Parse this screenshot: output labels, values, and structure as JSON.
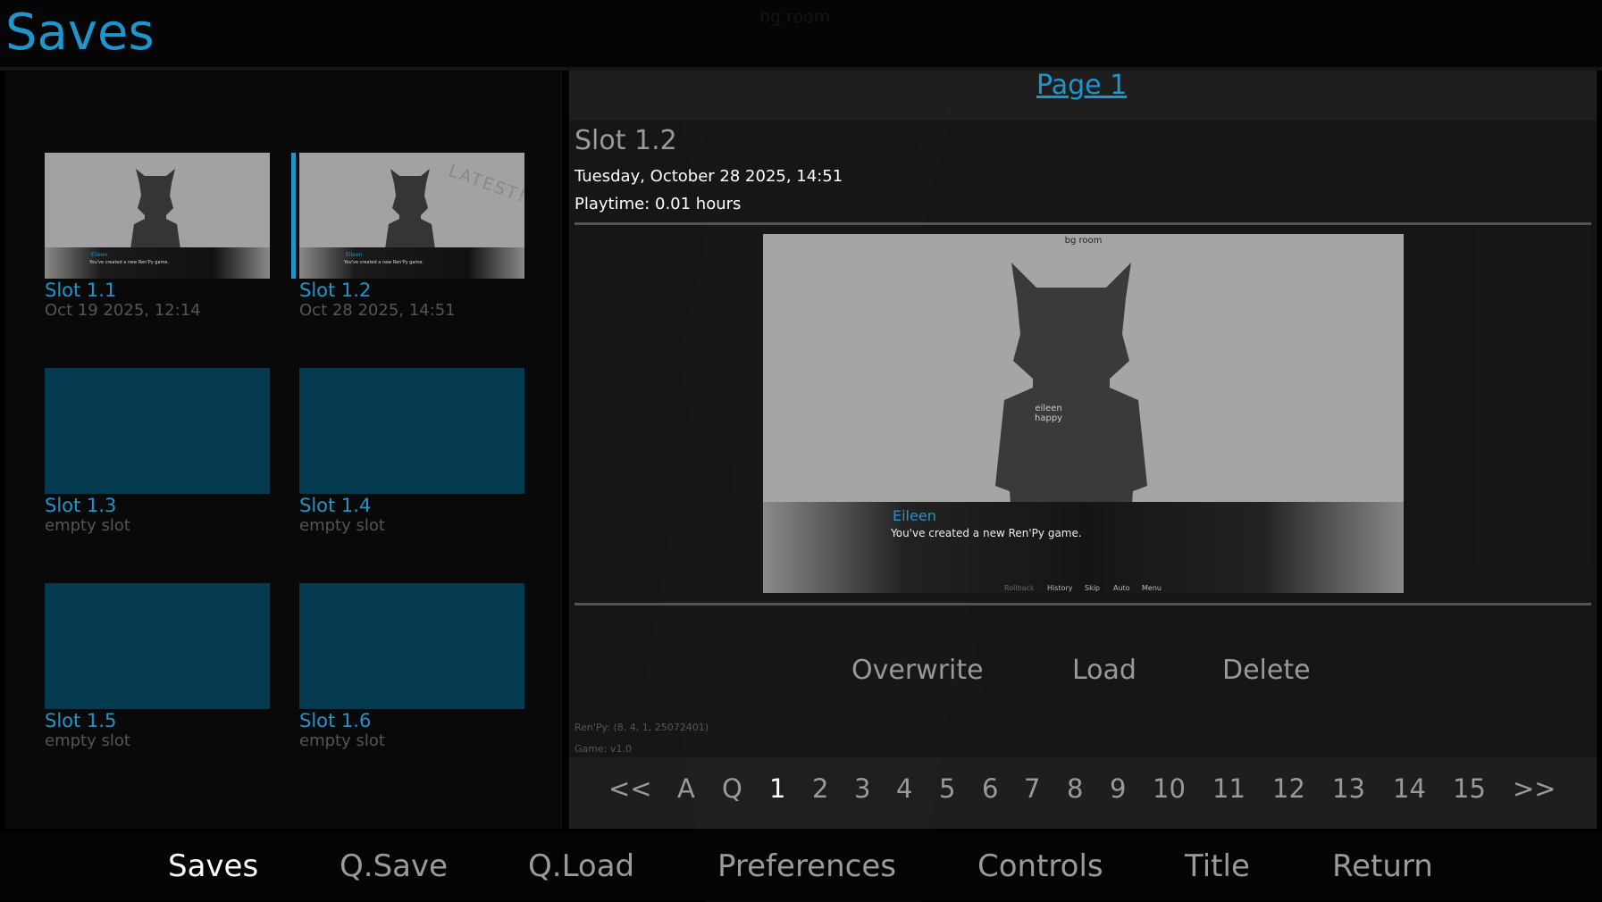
{
  "screen": {
    "title": "Saves",
    "background_label": "bg room"
  },
  "slots": [
    {
      "name": "Slot 1.1",
      "date": "Oct 19 2025, 12:14",
      "filled": true,
      "thumb_name": "Eileen",
      "thumb_line": "You've created a new Ren'Py game."
    },
    {
      "name": "Slot 1.2",
      "date": "Oct 28 2025, 14:51",
      "filled": true,
      "latest": "LATEST!",
      "thumb_name": "Eileen",
      "thumb_line": "You've created a new Ren'Py game."
    },
    {
      "name": "Slot 1.3",
      "date": "empty slot",
      "filled": false
    },
    {
      "name": "Slot 1.4",
      "date": "empty slot",
      "filled": false
    },
    {
      "name": "Slot 1.5",
      "date": "empty slot",
      "filled": false
    },
    {
      "name": "Slot 1.6",
      "date": "empty slot",
      "filled": false
    }
  ],
  "page_title": "Page 1",
  "detail": {
    "slot": "Slot 1.2",
    "date": "Tuesday, October 28 2025, 14:51",
    "playtime": "Playtime: 0.01 hours",
    "screenshot": {
      "header": "bg room",
      "character_tag": "eileen\nhappy",
      "speaker": "Eileen",
      "line": "You've created a new Ren'Py game.",
      "quick_menu": [
        "Rollback",
        "History",
        "Skip",
        "Auto",
        "Menu"
      ]
    },
    "actions": [
      "Overwrite",
      "Load",
      "Delete"
    ],
    "renpy_version": "Ren'Py: (8, 4, 1, 25072401)",
    "game_version": "Game: v1.0"
  },
  "pager": [
    "<<",
    "A",
    "Q",
    "1",
    "2",
    "3",
    "4",
    "5",
    "6",
    "7",
    "8",
    "9",
    "10",
    "11",
    "12",
    "13",
    "14",
    "15",
    ">>"
  ],
  "pager_current": "1",
  "nav": [
    "Saves",
    "Q.Save",
    "Q.Load",
    "Preferences",
    "Controls",
    "Title",
    "Return"
  ],
  "nav_current": "Saves",
  "colors": {
    "accent": "#1e96cc",
    "empty_slot": "#033a4f"
  }
}
